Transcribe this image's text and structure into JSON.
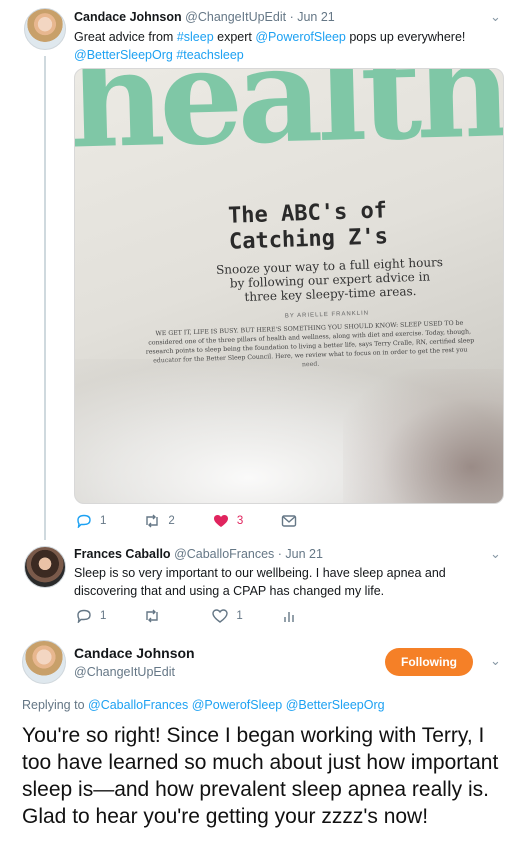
{
  "tweet1": {
    "name": "Candace Johnson",
    "handle": "@ChangeItUpEdit",
    "time": "· Jun 21",
    "text_prefix": "Great advice from ",
    "hashtag_sleep": "#sleep",
    "text_middle": " expert ",
    "mention": "@PowerofSleep",
    "text_suffix": " pops up everywhere!",
    "mention2": "@BetterSleepOrg",
    "hashtag_teach": "#teachsleep",
    "photo": {
      "masthead": "healthy",
      "headline": "The ABC's of Catching Z's",
      "subhead": "Snooze your way to a full eight hours by following our expert advice in three key sleepy-time areas.",
      "byline": "BY ARIELLE FRANKLIN",
      "body": "WE GET IT, LIFE IS BUSY. BUT HERE'S SOMETHING YOU SHOULD KNOW: SLEEP USED TO be considered one of the three pillars of health and wellness, along with diet and exercise. Today, though, research points to sleep being the foundation to living a better life, says Terry Cralle, RN, certified sleep educator for the Better Sleep Council. Here, we review what to focus on in order to get the rest you need."
    },
    "replies": "1",
    "retweets": "2",
    "likes": "3",
    "like_color": "#e0245e"
  },
  "tweet2": {
    "name": "Frances Caballo",
    "handle": "@CaballoFrances",
    "time": "· Jun 21",
    "text": "Sleep is so very important to our wellbeing. I have sleep apnea and discovering that and using a CPAP has changed my life.",
    "replies": "1",
    "likes": "1"
  },
  "tweet3": {
    "name": "Candace Johnson",
    "handle": "@ChangeItUpEdit",
    "follow_label": "Following",
    "follow_color": "#f58027",
    "replying_label": "Replying to ",
    "replying_mentions": "@CaballoFrances @PowerofSleep @BetterSleepOrg",
    "text": "You're so right! Since I began working with Terry, I too have learned so much about just how important sleep is—and how prevalent sleep apnea really is. Glad to hear you're getting your zzzz's now!"
  },
  "icons": {
    "reply": "reply-icon",
    "retweet": "retweet-icon",
    "like": "heart-icon",
    "dm": "envelope-icon",
    "analytics": "analytics-icon",
    "menu": "chevron-down-icon"
  }
}
